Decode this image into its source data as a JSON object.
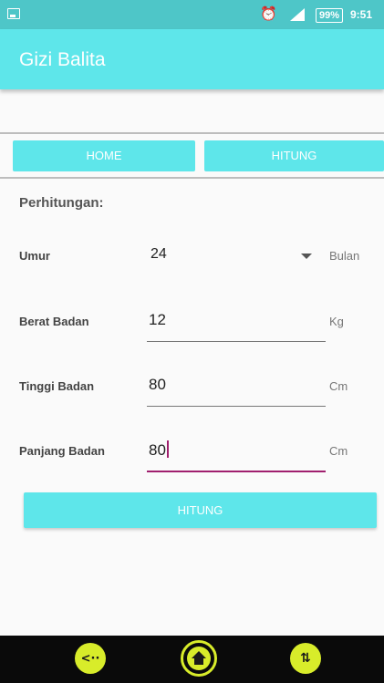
{
  "status_bar": {
    "alarm_icon": "alarm-icon",
    "signal_icon": "signal-icon",
    "battery": "99%",
    "time": "9:51"
  },
  "app_bar": {
    "title": "Gizi Balita"
  },
  "nav": {
    "home_label": "HOME",
    "hitung_label": "HITUNG"
  },
  "form": {
    "section_title": "Perhitungan:",
    "umur": {
      "label": "Umur",
      "value": "24",
      "unit": "Bulan"
    },
    "berat": {
      "label": "Berat Badan",
      "value": "12",
      "unit": "Kg"
    },
    "tinggi": {
      "label": "Tinggi Badan",
      "value": "80",
      "unit": "Cm"
    },
    "panjang": {
      "label": "Panjang Badan",
      "value": "80",
      "unit": "Cm"
    },
    "submit_label": "HITUNG"
  },
  "colors": {
    "accent": "#5ee6ea",
    "status_bar": "#4ec6c8",
    "focus": "#a01f6e"
  },
  "system_nav": {
    "left_icon": "back-icon",
    "center_icon": "home-icon",
    "right_icon": "menu-icon"
  }
}
